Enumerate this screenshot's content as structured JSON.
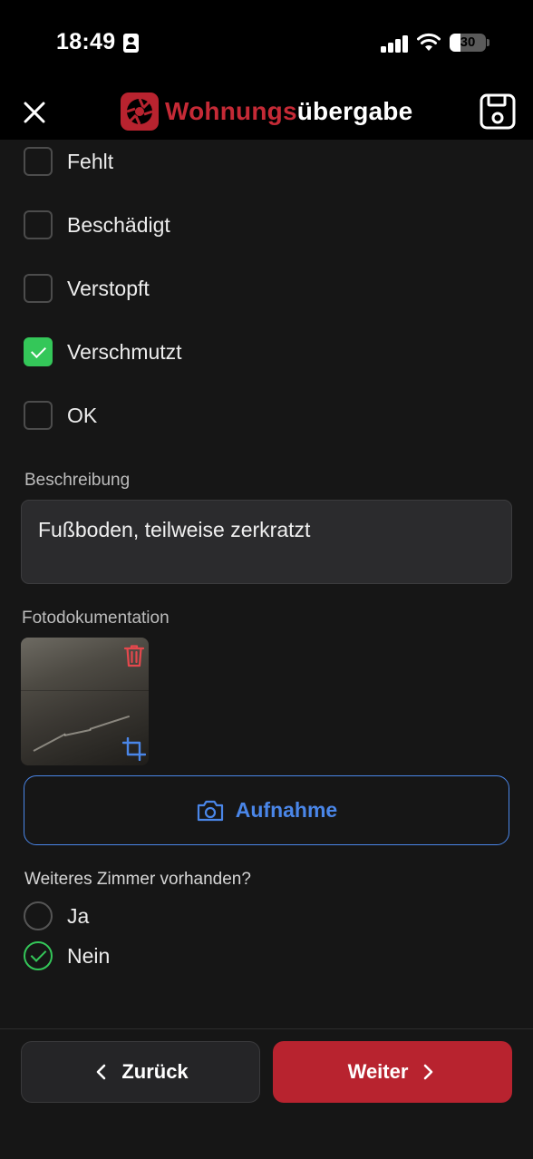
{
  "status_bar": {
    "time": "18:49",
    "battery_level": "30",
    "battery_fraction": 0.3
  },
  "header": {
    "logo_part1": "Wohnungs",
    "logo_part2": "übergabe",
    "brand_color": "#b8232f"
  },
  "condition_options": [
    {
      "label": "Fehlt",
      "checked": false
    },
    {
      "label": "Beschädigt",
      "checked": false
    },
    {
      "label": "Verstopft",
      "checked": false
    },
    {
      "label": "Verschmutzt",
      "checked": true
    },
    {
      "label": "OK",
      "checked": false
    }
  ],
  "description": {
    "label": "Beschreibung",
    "value": "Fußboden, teilweise zerkratzt"
  },
  "photos": {
    "label": "Fotodokumentation",
    "capture_label": "Aufnahme"
  },
  "another_room": {
    "question": "Weiteres Zimmer vorhanden?",
    "options": [
      {
        "label": "Ja",
        "selected": false
      },
      {
        "label": "Nein",
        "selected": true
      }
    ]
  },
  "footer": {
    "back_label": "Zurück",
    "next_label": "Weiter"
  },
  "colors": {
    "accent_blue": "#4a86e8",
    "check_green": "#34c759",
    "delete_red": "#e5484d"
  }
}
